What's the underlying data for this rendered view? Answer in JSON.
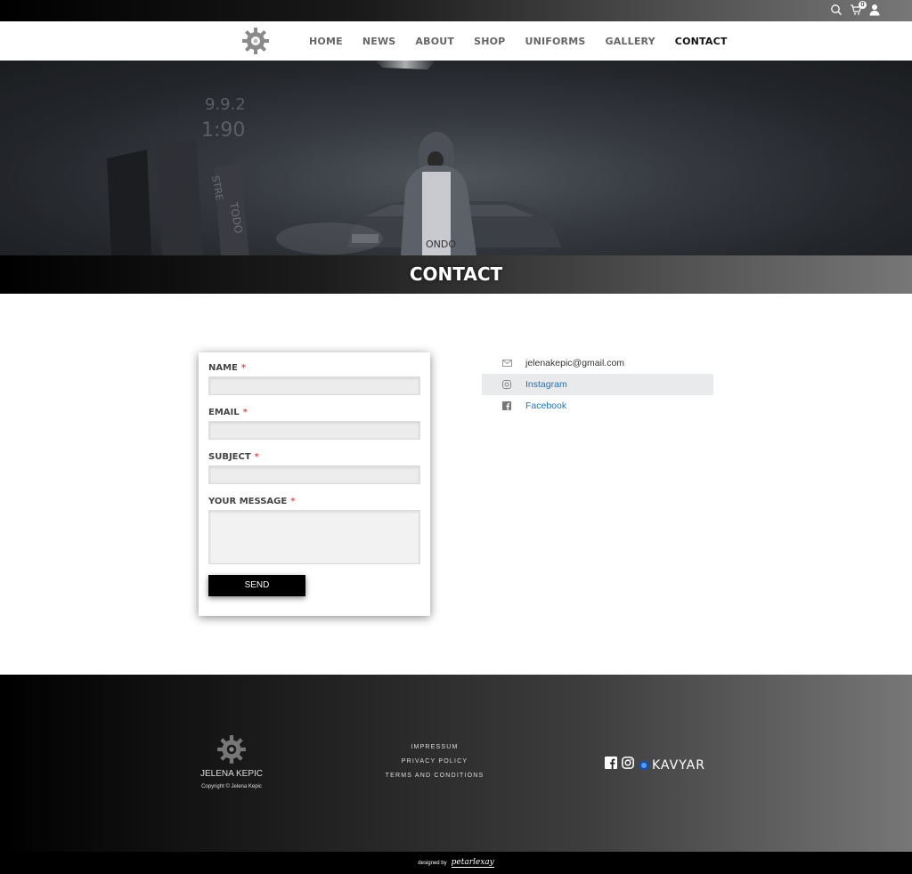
{
  "topbar": {
    "cart_count": "0",
    "icons": [
      "search-icon",
      "cart-icon",
      "user-icon"
    ]
  },
  "nav": {
    "items": [
      "HOME",
      "NEWS",
      "ABOUT",
      "SHOP",
      "UNIFORMS",
      "GALLERY",
      "CONTACT"
    ],
    "active": "CONTACT"
  },
  "hero": {
    "sign_text_1": "9.9.2",
    "sign_text_2": "1:90",
    "sign_text_3": "TODO",
    "sign_text_4": "STRE",
    "shirt_text": "ONDO"
  },
  "page": {
    "title": "CONTACT"
  },
  "form": {
    "name_label": "NAME",
    "email_label": "EMAIL",
    "subject_label": "SUBJECT",
    "message_label": "YOUR MESSAGE",
    "required_mark": "*",
    "send_label": "SEND",
    "name_value": "",
    "email_value": "",
    "subject_value": "",
    "message_value": ""
  },
  "contacts": {
    "email": "jelenakepic@gmail.com",
    "instagram": "Instagram",
    "facebook": "Facebook"
  },
  "footer": {
    "name": "JELENA KEPIC",
    "copyright": "Copyright © Jelena Kepic",
    "links": [
      "IMPRESSUM",
      "PRIVACY POLICY",
      "TERMS AND CONDITIONS"
    ],
    "kavyar": "KAVYAR",
    "designed_by": "designed by",
    "designer": "petarlexay"
  },
  "colors": {
    "accent_link": "#1e73be",
    "required": "#e05252",
    "highlight_row": "#e9eaec"
  }
}
